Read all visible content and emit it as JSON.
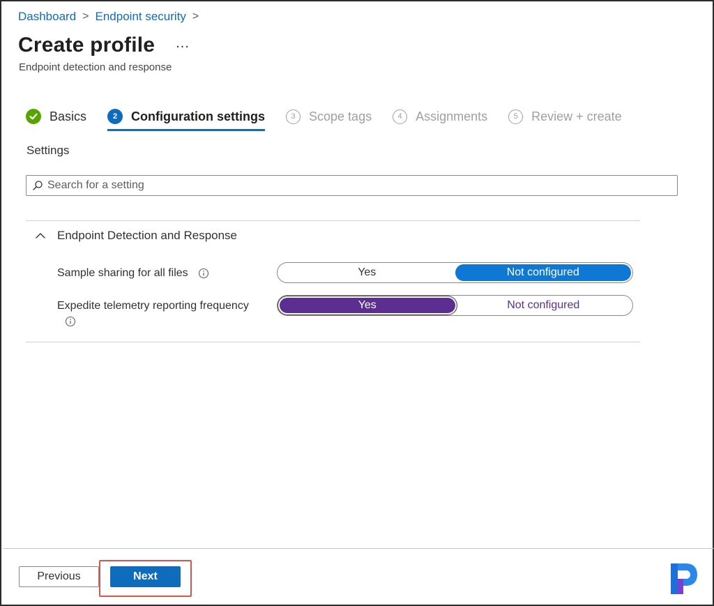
{
  "breadcrumb": {
    "items": [
      "Dashboard",
      "Endpoint security"
    ],
    "separator": ">"
  },
  "header": {
    "title": "Create profile",
    "more": "...",
    "subtitle": "Endpoint detection and response"
  },
  "steps": [
    {
      "number": "",
      "label": "Basics",
      "state": "done"
    },
    {
      "number": "2",
      "label": "Configuration settings",
      "state": "active"
    },
    {
      "number": "3",
      "label": "Scope tags",
      "state": "todo"
    },
    {
      "number": "4",
      "label": "Assignments",
      "state": "todo"
    },
    {
      "number": "5",
      "label": "Review + create",
      "state": "todo"
    }
  ],
  "settings": {
    "label": "Settings",
    "search_placeholder": "Search for a setting",
    "section_title": "Endpoint Detection and Response",
    "rows": [
      {
        "name": "Sample sharing for all files",
        "options": [
          "Yes",
          "Not configured"
        ],
        "selected": "Not configured"
      },
      {
        "name": "Expedite telemetry reporting frequency",
        "options": [
          "Yes",
          "Not configured"
        ],
        "selected": "Yes"
      }
    ]
  },
  "footer": {
    "previous_label": "Previous",
    "next_label": "Next"
  },
  "colors": {
    "accent": "#0f6cbd",
    "done_green": "#57a300",
    "selected_purple": "#5c2e91",
    "highlight_red": "#d9534f"
  }
}
